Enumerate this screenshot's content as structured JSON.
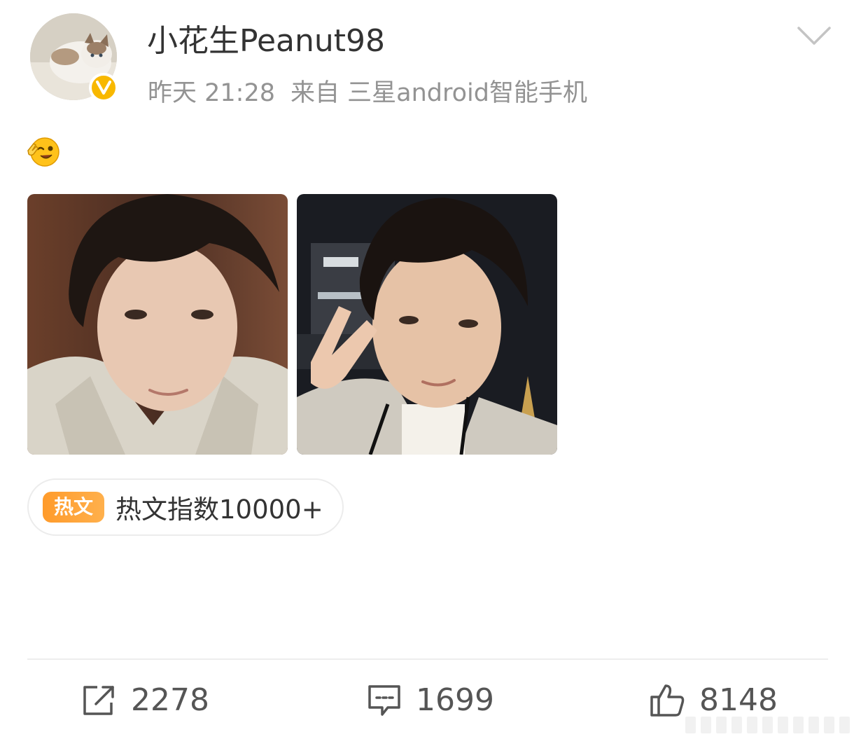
{
  "post": {
    "author": {
      "name": "小花生Peanut98",
      "verified_badge": "V"
    },
    "timestamp": "昨天 21:28",
    "source": "来自 三星android智能手机",
    "content_emoji": "wink-peace-emoji",
    "images": [
      {
        "icon": "selfie-photo-indoor"
      },
      {
        "icon": "selfie-photo-night-peace-sign"
      }
    ],
    "hot_tag": {
      "badge": "热文",
      "text": "热文指数10000+"
    }
  },
  "actions": {
    "repost": {
      "icon": "repost-icon",
      "count": "2278"
    },
    "comment": {
      "icon": "comment-icon",
      "count": "1699"
    },
    "like": {
      "icon": "thumbs-up-icon",
      "count": "8148"
    }
  },
  "colors": {
    "badge_yellow": "#f8b800",
    "hot_orange": "#ff9b2b",
    "meta_gray": "#939393",
    "text_dark": "#333333"
  }
}
